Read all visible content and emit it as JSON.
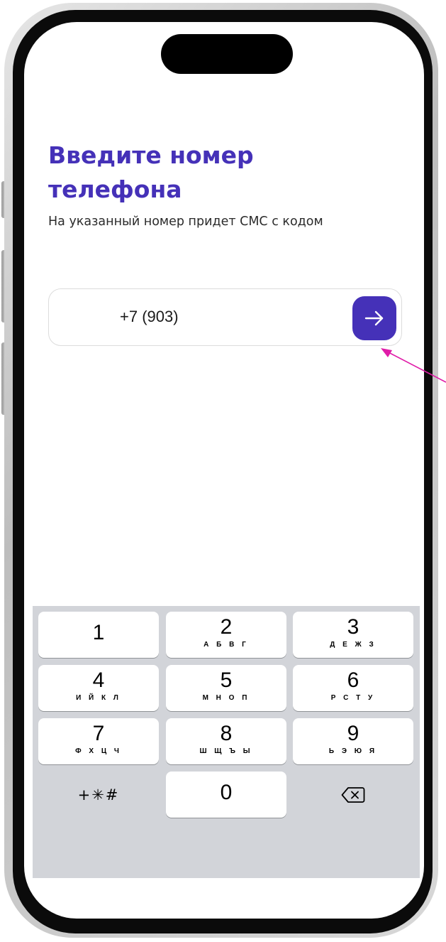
{
  "heading": {
    "title": "Введите номер телефона",
    "subtitle": "На указанный номер придет СМС с кодом"
  },
  "phone_input": {
    "value": "+7 (903)"
  },
  "submit_button": {
    "icon": "arrow-right-icon"
  },
  "keypad": {
    "keys": [
      {
        "digit": "1",
        "letters": ""
      },
      {
        "digit": "2",
        "letters": "А Б В Г"
      },
      {
        "digit": "3",
        "letters": "Д Е Ж З"
      },
      {
        "digit": "4",
        "letters": "И Й К Л"
      },
      {
        "digit": "5",
        "letters": "М Н О П"
      },
      {
        "digit": "6",
        "letters": "Р С Т У"
      },
      {
        "digit": "7",
        "letters": "Ф Х Ц Ч"
      },
      {
        "digit": "8",
        "letters": "Ш Щ Ъ Ы"
      },
      {
        "digit": "9",
        "letters": "Ь Э Ю Я"
      },
      {
        "digit": "0",
        "letters": ""
      }
    ],
    "symbols_label": "+✳#",
    "delete_icon": "backspace-icon"
  },
  "colors": {
    "accent": "#4531b8",
    "keyboard_bg": "#d2d4d9",
    "annotation_arrow": "#e01ca8"
  }
}
